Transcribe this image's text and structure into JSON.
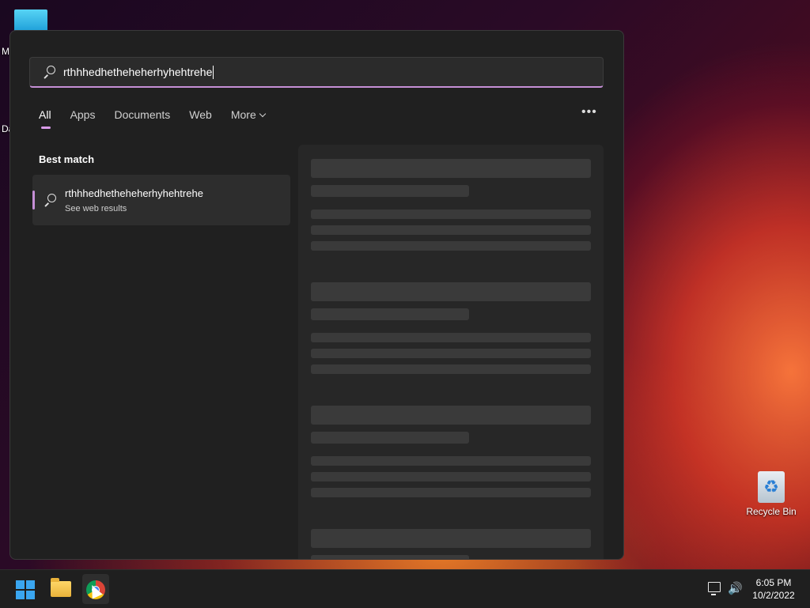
{
  "desktop": {
    "frag_top": "M",
    "frag_mid": "Da",
    "recycle_bin_label": "Recycle Bin"
  },
  "search": {
    "query": "rthhhedhetheheherhyhehtrehe"
  },
  "tabs": [
    {
      "label": "All",
      "active": true
    },
    {
      "label": "Apps"
    },
    {
      "label": "Documents"
    },
    {
      "label": "Web"
    },
    {
      "label": "More"
    }
  ],
  "more_options_glyph": "•••",
  "best_match": {
    "heading": "Best match",
    "title": "rthhhedhetheheherhyhehtrehe",
    "subtitle": "See web results"
  },
  "taskbar": {
    "time": "6:05 PM",
    "date": "10/2/2022",
    "volume_icon": "🔊"
  },
  "colors": {
    "accent": "#c58fd6",
    "panel_bg": "#202020",
    "taskbar_bg": "#1f1f1f"
  }
}
